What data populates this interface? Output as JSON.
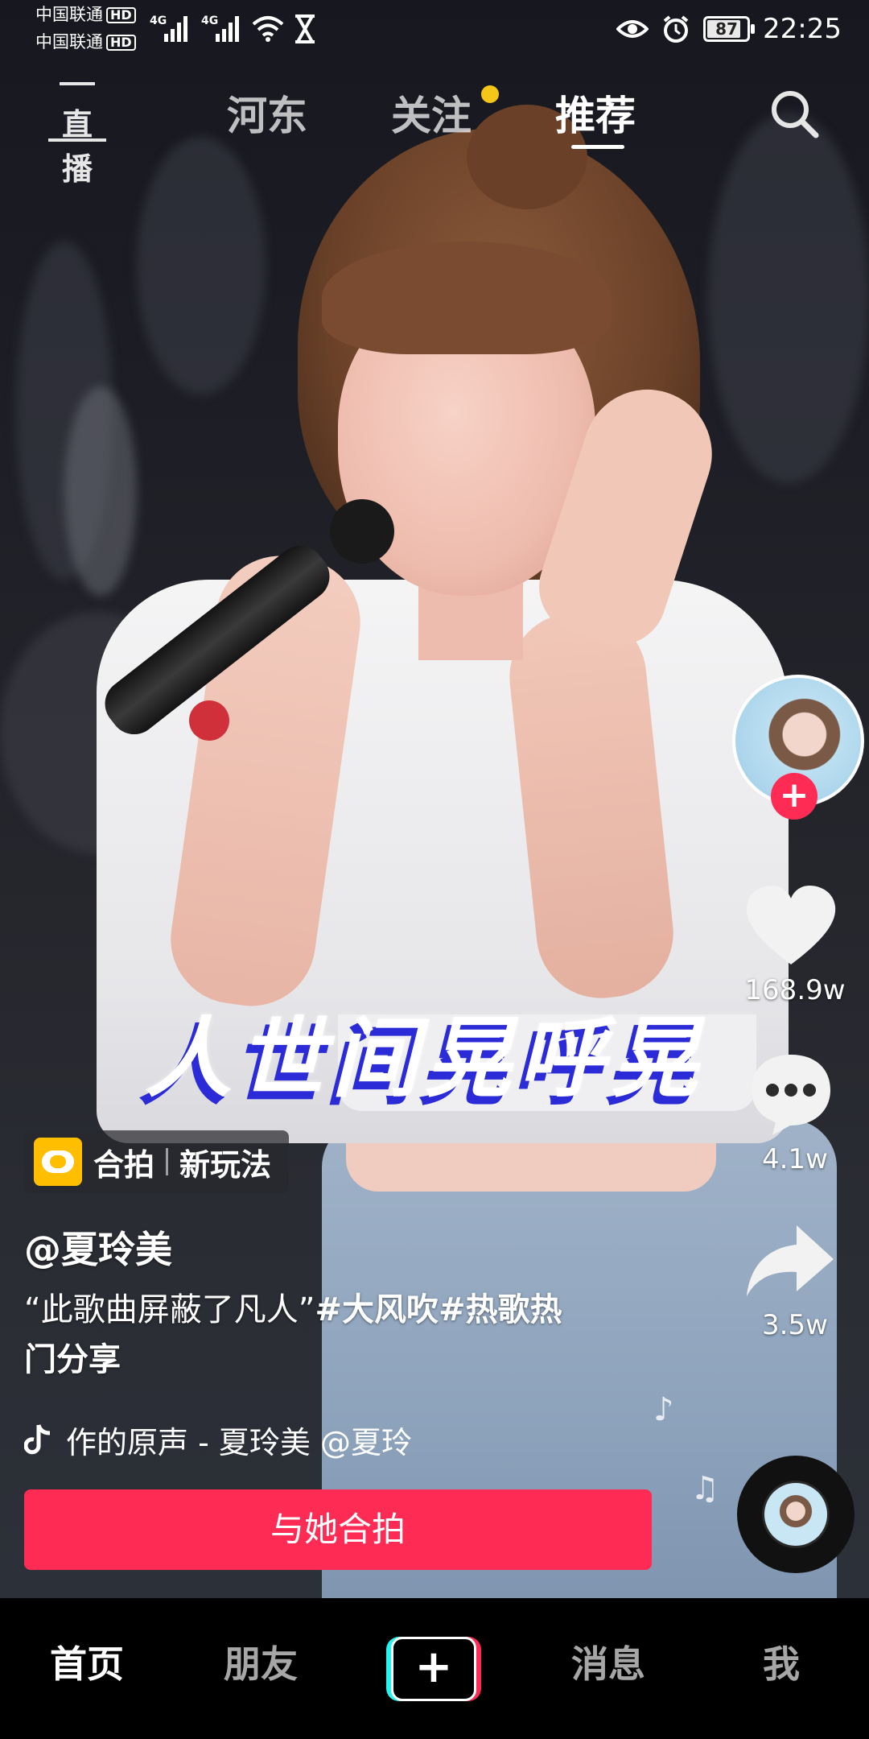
{
  "status_bar": {
    "carrier1": "中国联通",
    "carrier2": "中国联通",
    "hd": "HD",
    "network1": "4G",
    "network2": "4G",
    "battery": "87",
    "time": "22:25"
  },
  "top_nav": {
    "live_label": "直播",
    "tabs": [
      "河东",
      "关注",
      "推荐"
    ],
    "active_tab": "推荐"
  },
  "video": {
    "lyric": "人世间晃呼晃",
    "duet_badge": {
      "left": "合拍",
      "right": "新玩法"
    },
    "author": "@夏玲美",
    "caption_plain": "“此歌曲屏蔽了凡人”",
    "caption_tag1": "#大风吹",
    "caption_tag2": "#热歌热",
    "caption_line2": "门分享",
    "music": "作的原声 - 夏玲美    @夏玲",
    "duet_button": "与她合拍"
  },
  "actions": {
    "likes": "168.9w",
    "comments": "4.1w",
    "shares": "3.5w"
  },
  "bottom_nav": {
    "items": [
      "首页",
      "朋友",
      "消息",
      "我"
    ],
    "create": "+",
    "active": "首页"
  },
  "colors": {
    "accent": "#fe2c55",
    "notify_dot": "#f5c518",
    "duet_logo": "#ffbf00",
    "cyan": "#25f4ee"
  }
}
